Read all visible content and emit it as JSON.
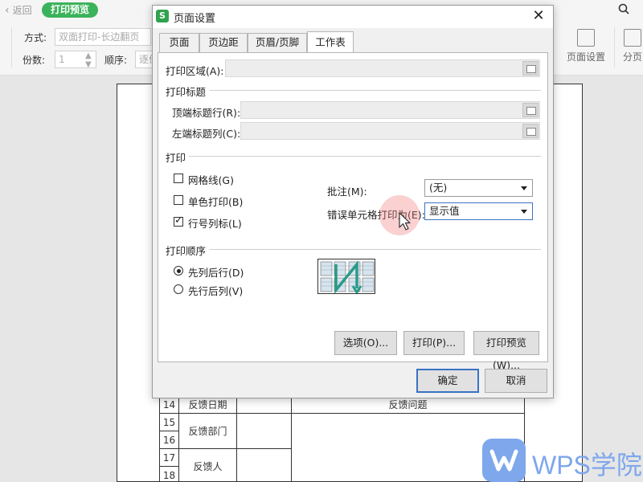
{
  "topbar": {
    "back_label": "返回",
    "preview_label": "打印预览"
  },
  "ribbon": {
    "mode_label": "方式:",
    "mode_value": "双面打印-长边翻页",
    "copies_label": "份数:",
    "copies_value": "1",
    "order_label": "顺序:",
    "order_value": "逐份",
    "page_setup_label": "页面设置",
    "split_label": "分页"
  },
  "sheet": {
    "rows": [
      {
        "num": "14",
        "label": "反馈日期",
        "value": "反馈问题"
      },
      {
        "num": "15",
        "label": "反馈部门",
        "value": ""
      },
      {
        "num": "16",
        "label": "",
        "value": ""
      },
      {
        "num": "17",
        "label": "反馈人",
        "value": ""
      },
      {
        "num": "18",
        "label": "",
        "value": ""
      }
    ]
  },
  "watermark": {
    "text": "WPS学院"
  },
  "dialog": {
    "icon_letter": "S",
    "title": "页面设置",
    "tabs": [
      "页面",
      "页边距",
      "页眉/页脚",
      "工作表"
    ],
    "active_tab": "工作表",
    "print_area_label": "打印区域(A):",
    "print_titles_group": "打印标题",
    "top_rows_label": "顶端标题行(R):",
    "left_cols_label": "左端标题列(C):",
    "print_group": "打印",
    "gridlines_label": "网格线(G)",
    "gridlines_checked": false,
    "mono_label": "单色打印(B)",
    "mono_checked": false,
    "headings_label": "行号列标(L)",
    "headings_checked": true,
    "comments_label": "批注(M):",
    "comments_value": "(无)",
    "errors_label": "错误单元格打印为(E):",
    "errors_value": "显示值",
    "order_group": "打印顺序",
    "down_then_over_label": "先列后行(D)",
    "over_then_down_label": "先行后列(V)",
    "order_selected": "down_then_over",
    "options_button": "选项(O)...",
    "print_button": "打印(P)...",
    "preview_button": "打印预览(W)...",
    "ok_button": "确定",
    "cancel_button": "取消"
  },
  "colors": {
    "accent_green": "#3bb35b",
    "focus_blue": "#3a72c4",
    "watermark_blue": "#7ea7ec"
  }
}
